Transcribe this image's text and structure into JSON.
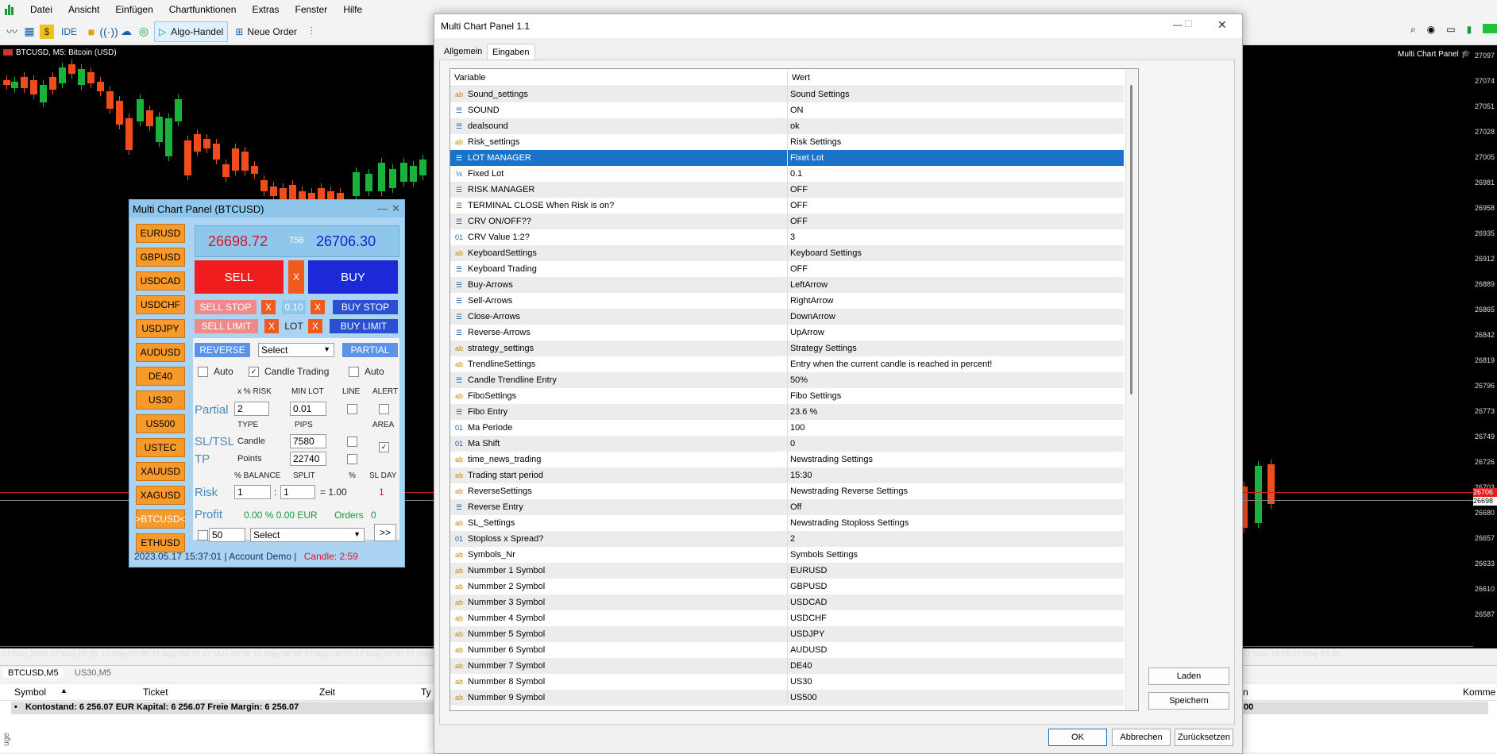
{
  "menu": [
    "Datei",
    "Ansicht",
    "Einfügen",
    "Chartfunktionen",
    "Extras",
    "Fenster",
    "Hilfe"
  ],
  "toolbar": {
    "ide": "IDE",
    "algo": "Algo-Handel",
    "new_order": "Neue Order"
  },
  "chart": {
    "symbol_label": "BTCUSD, M5:  Bitcoin (USD)",
    "indicator_label": "Multi Chart Panel",
    "price_ticks": [
      "27097",
      "27074",
      "27051",
      "27028",
      "27005",
      "26981",
      "26958",
      "26935",
      "26912",
      "26889",
      "26865",
      "26842",
      "26819",
      "26796",
      "26773",
      "26749",
      "26726",
      "26703",
      "26680",
      "26657",
      "26633",
      "26610",
      "26587"
    ],
    "current_price_tags": [
      "26706",
      "26698"
    ],
    "time_labels": [
      "17 May 2023",
      "17 May 07:35",
      "17 May 07:55",
      "17 May 08:15",
      "17 May 08:35",
      "17 May 08:55",
      "17 May 09:15",
      "17 May 09:35",
      "17 May"
    ],
    "time_labels_right": [
      "17 May 15:15",
      "17 May 15:35"
    ]
  },
  "panel": {
    "title": "Multi Chart Panel (BTCUSD)",
    "symbols": [
      "EURUSD",
      "GBPUSD",
      "USDCAD",
      "USDCHF",
      "USDJPY",
      "AUDUSD",
      "DE40",
      "US30",
      "US500",
      "USTEC",
      "XAUUSD",
      "XAGUSD",
      ">BTCUSD<",
      "ETHUSD"
    ],
    "bid": "26698.72",
    "spread": "758",
    "ask": "26706.30",
    "sell": "SELL",
    "buy": "BUY",
    "x": "X",
    "sell_stop": "SELL STOP",
    "buy_stop": "BUY STOP",
    "lot_value": "0.10",
    "sell_limit": "SELL LIMIT",
    "lot": "LOT",
    "buy_limit": "BUY LIMIT",
    "reverse": "REVERSE",
    "select": "Select",
    "partial": "PARTIAL",
    "auto": "Auto",
    "candle_trading": "Candle Trading",
    "x_risk": "x % RISK",
    "min_lot": "MIN LOT",
    "line": "LINE",
    "alert": "ALERT",
    "partial_label": "Partial",
    "partial_val": "2",
    "min_lot_val": "0.01",
    "type": "TYPE",
    "pips": "PIPS",
    "area": "AREA",
    "sltsl": "SL/TSL",
    "candle": "Candle",
    "candle_val": "7580",
    "tp": "TP",
    "points": "Points",
    "points_val": "22740",
    "balance": "% BALANCE",
    "split": "SPLIT",
    "pct": "%",
    "slday": "SL DAY",
    "risk": "Risk",
    "risk_val": "1",
    "split_val": "1",
    "colon": ":",
    "eq": "= 1.00",
    "slday_val": "1",
    "profit": "Profit",
    "profit_val": "0.00 % 0.00 EUR",
    "orders": "Orders",
    "orders_val": "0",
    "bottom_spin": "50",
    "bottom_select": "Select",
    "more": ">>",
    "status_time": "2023.05.17 15:37:01",
    "status_sep": "|",
    "account": "Account Demo",
    "candle_timer": "Candle: 2:59"
  },
  "bottom": {
    "tabs": [
      "BTCUSD,M5",
      "US30,M5"
    ],
    "columns": [
      "Symbol",
      "Ticket",
      "Zeit",
      "Ty"
    ],
    "right_cols": [
      "n",
      "Komme"
    ],
    "account_line": "Kontostand: 6 256.07 EUR  Kapital: 6 256.07  Freie Margin: 6 256.07",
    "right_val": "00",
    "side_label": "uge"
  },
  "dialog": {
    "title": "Multi Chart Panel 1.1",
    "tabs": [
      "Allgemein",
      "Eingaben"
    ],
    "col_variable": "Variable",
    "col_value": "Wert",
    "rows": [
      {
        "icon": "ab",
        "var": "Sound_settings",
        "val": "Sound Settings"
      },
      {
        "icon": "en",
        "var": "SOUND",
        "val": "ON"
      },
      {
        "icon": "en",
        "var": "dealsound",
        "val": "ok"
      },
      {
        "icon": "ab",
        "var": "Risk_settings",
        "val": "Risk Settings"
      },
      {
        "icon": "en",
        "var": "LOT MANAGER",
        "val": "Fixet Lot",
        "selected": true
      },
      {
        "icon": "½",
        "var": "Fixed Lot",
        "val": "0.1"
      },
      {
        "icon": "en",
        "var": "RISK MANAGER",
        "val": "OFF"
      },
      {
        "icon": "en",
        "var": "TERMINAL CLOSE When Risk is on?",
        "val": "OFF"
      },
      {
        "icon": "en",
        "var": "CRV ON/OFF??",
        "val": "OFF"
      },
      {
        "icon": "01",
        "var": "CRV Value 1:2?",
        "val": "3"
      },
      {
        "icon": "ab",
        "var": "KeyboardSettings",
        "val": "Keyboard Settings"
      },
      {
        "icon": "en",
        "var": "Keyboard Trading",
        "val": "OFF"
      },
      {
        "icon": "en",
        "var": "Buy-Arrows",
        "val": "LeftArrow"
      },
      {
        "icon": "en",
        "var": "Sell-Arrows",
        "val": "RightArrow"
      },
      {
        "icon": "en",
        "var": "Close-Arrows",
        "val": "DownArrow"
      },
      {
        "icon": "en",
        "var": "Reverse-Arrows",
        "val": "UpArrow"
      },
      {
        "icon": "ab",
        "var": "strategy_settings",
        "val": "Strategy Settings"
      },
      {
        "icon": "ab",
        "var": "TrendlineSettings",
        "val": "Entry when the current candle is reached in percent!"
      },
      {
        "icon": "en",
        "var": "Candle Trendline Entry",
        "val": "50%"
      },
      {
        "icon": "ab",
        "var": "FiboSettings",
        "val": "Fibo Settings"
      },
      {
        "icon": "en",
        "var": "Fibo Entry",
        "val": "23.6 %"
      },
      {
        "icon": "01",
        "var": "Ma Periode",
        "val": "100"
      },
      {
        "icon": "01",
        "var": "Ma Shift",
        "val": "0"
      },
      {
        "icon": "ab",
        "var": "time_news_trading",
        "val": "Newstrading Settings"
      },
      {
        "icon": "ab",
        "var": "Trading start period",
        "val": "15:30"
      },
      {
        "icon": "ab",
        "var": "ReverseSettings",
        "val": "Newstrading Reverse Settings"
      },
      {
        "icon": "en",
        "var": "Reverse Entry",
        "val": "Off"
      },
      {
        "icon": "ab",
        "var": "SL_Settings",
        "val": "Newstrading Stoploss Settings"
      },
      {
        "icon": "01",
        "var": "Stoploss x Spread?",
        "val": "2"
      },
      {
        "icon": "ab",
        "var": "Symbols_Nr",
        "val": "Symbols Settings"
      },
      {
        "icon": "ab",
        "var": "Nummber 1 Symbol",
        "val": "EURUSD"
      },
      {
        "icon": "ab",
        "var": "Nummber 2 Symbol",
        "val": "GBPUSD"
      },
      {
        "icon": "ab",
        "var": "Nummber 3 Symbol",
        "val": "USDCAD"
      },
      {
        "icon": "ab",
        "var": "Nummber 4 Symbol",
        "val": "USDCHF"
      },
      {
        "icon": "ab",
        "var": "Nummber 5 Symbol",
        "val": "USDJPY"
      },
      {
        "icon": "ab",
        "var": "Nummber 6 Symbol",
        "val": "AUDUSD"
      },
      {
        "icon": "ab",
        "var": "Nummber 7 Symbol",
        "val": "DE40"
      },
      {
        "icon": "ab",
        "var": "Nummber 8 Symbol",
        "val": "US30"
      },
      {
        "icon": "ab",
        "var": "Nummber 9 Symbol",
        "val": "US500"
      }
    ],
    "load": "Laden",
    "save": "Speichern",
    "ok": "OK",
    "cancel": "Abbrechen",
    "reset": "Zurücksetzen"
  },
  "colors": {
    "bull": "#19b33c",
    "bear": "#f04c1c",
    "accent": "#1a73c8"
  }
}
